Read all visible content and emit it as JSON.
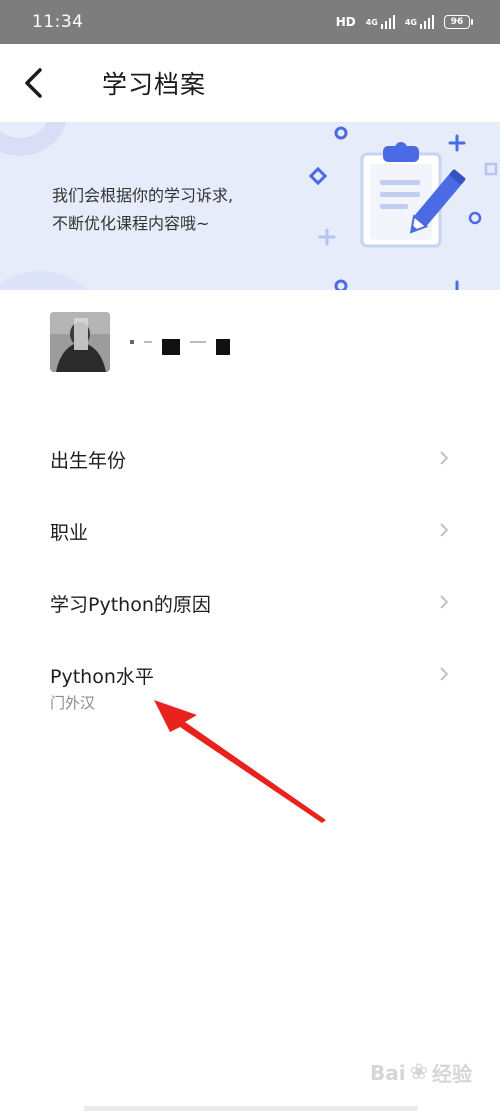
{
  "status_bar": {
    "time": "11:34",
    "network_1": "HD",
    "network_2": "4G",
    "network_3": "4G",
    "battery": "96"
  },
  "header": {
    "title": "学习档案",
    "back_icon": "back-arrow-icon"
  },
  "banner": {
    "line1": "我们会根据你的学习诉求,",
    "line2": "不断优化课程内容哦~",
    "illustration": "clipboard-pencil-icon",
    "bg_color": "#e7ecfb",
    "accent_color": "#3f63e0"
  },
  "profile": {
    "avatar_icon": "avatar",
    "nickname": ""
  },
  "menu": {
    "items": [
      {
        "label": "出生年份",
        "value": ""
      },
      {
        "label": "职业",
        "value": ""
      },
      {
        "label": "学习Python的原因",
        "value": ""
      },
      {
        "label": "Python水平",
        "value": "门外汉"
      }
    ]
  },
  "watermark": {
    "text": "Bai",
    "text2": "经验"
  },
  "annotation_color": "#e8231e"
}
